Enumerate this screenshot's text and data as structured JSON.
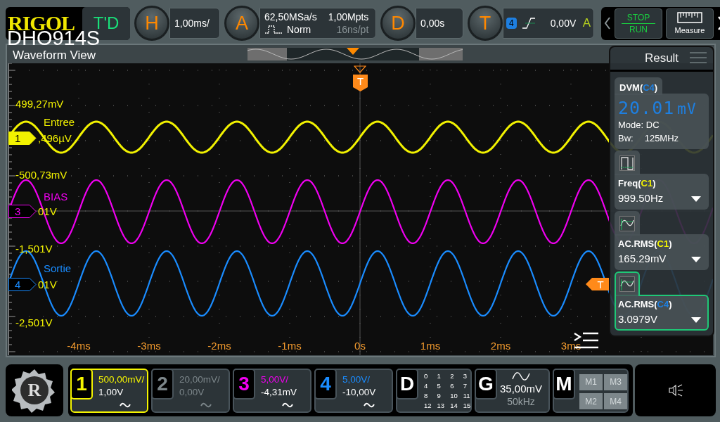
{
  "header": {
    "logo": "RIGOL",
    "model": "DHO914S",
    "mode_button": "T'D"
  },
  "status": [
    {
      "kind": "horizontal",
      "letter": "H",
      "value": "1,00ms/"
    },
    {
      "kind": "acquire",
      "letter": "A",
      "sample_rate": "62,50MSa/s",
      "mode": "Norm",
      "memory_depth": "1,00Mpts",
      "resolution": "16ns/pt"
    },
    {
      "kind": "delay",
      "letter": "D",
      "value": "0,00s"
    },
    {
      "kind": "trigger",
      "letter": "T",
      "source": "4",
      "level": "0,00V",
      "sweep": "A"
    }
  ],
  "controls": {
    "run_stop": {
      "top": "STOP",
      "bottom": "RUN"
    },
    "measure": "Measure"
  },
  "waveform_view": {
    "title": "Waveform View",
    "trigger_tag": "T",
    "side_trigger_tag": "T",
    "traces": [
      {
        "number": "1",
        "label": "Entree",
        "top_reading": "499,27mV",
        "offset_reading": ",496µV",
        "color": "#f2f200",
        "selected": true
      },
      {
        "number": "3",
        "label": "BIAS",
        "top_reading": "-500,73mV",
        "offset_reading": "01V",
        "color": "#f000f0",
        "selected": false
      },
      {
        "number": "4",
        "label": "Sortie",
        "top_reading": "-1,501V",
        "offset_reading": "01V",
        "color": "#1a8cff",
        "selected": false
      }
    ],
    "bottom_reading": "-2,501V",
    "time_labels": [
      "-4ms",
      "-3ms",
      "-2ms",
      "-1ms",
      "0s",
      "1ms",
      "2ms",
      "3ms"
    ]
  },
  "result": {
    "title": "Result",
    "items": [
      {
        "kind": "dvm",
        "title": "DVM(",
        "source": "C4",
        "suffix": ")",
        "color": "#1e7fe0",
        "reading": "20.01",
        "unit": "mV",
        "mode": "Mode: DC",
        "bw_label": "Bw:",
        "bw": "125MHz",
        "selected": false
      },
      {
        "kind": "measure",
        "title": "Freq(",
        "source": "C1",
        "suffix": ")",
        "color": "#f2f200",
        "value": "999.50Hz",
        "selected": false
      },
      {
        "kind": "measure",
        "title": "AC.RMS(",
        "source": "C1",
        "suffix": ")",
        "color": "#f2f200",
        "value": "165.29mV",
        "selected": false
      },
      {
        "kind": "measure",
        "title": "AC.RMS(",
        "source": "C4",
        "suffix": ")",
        "color": "#1e7fe0",
        "value": "3.0979V",
        "selected": true
      }
    ]
  },
  "bottom": {
    "launcher": "R",
    "channels": [
      {
        "number": "1",
        "scale": "500,00mV/",
        "offset": "1,00V",
        "color": "#f5f500",
        "enabled": true,
        "selected": true
      },
      {
        "number": "2",
        "scale": "20,00mV/",
        "offset": "0,00V",
        "enabled": false,
        "selected": false
      },
      {
        "number": "3",
        "scale": "5,00V/",
        "offset": "-4,31mV",
        "color": "#f000f0",
        "enabled": true,
        "selected": false
      },
      {
        "number": "4",
        "scale": "5,00V/",
        "offset": "-10,00V",
        "color": "#1a8cff",
        "enabled": true,
        "selected": false
      }
    ],
    "digital": {
      "letter": "D",
      "bits": [
        "0",
        "1",
        "2",
        "3",
        "4",
        "5",
        "6",
        "7",
        "8",
        "9",
        "10",
        "11",
        "12",
        "13",
        "14",
        "15"
      ]
    },
    "generator": {
      "letter": "G",
      "amplitude": "35,00mV",
      "frequency": "50kHz"
    },
    "math": {
      "letter": "M",
      "slots": [
        "M1",
        "M3",
        "M2",
        "M4"
      ]
    }
  }
}
